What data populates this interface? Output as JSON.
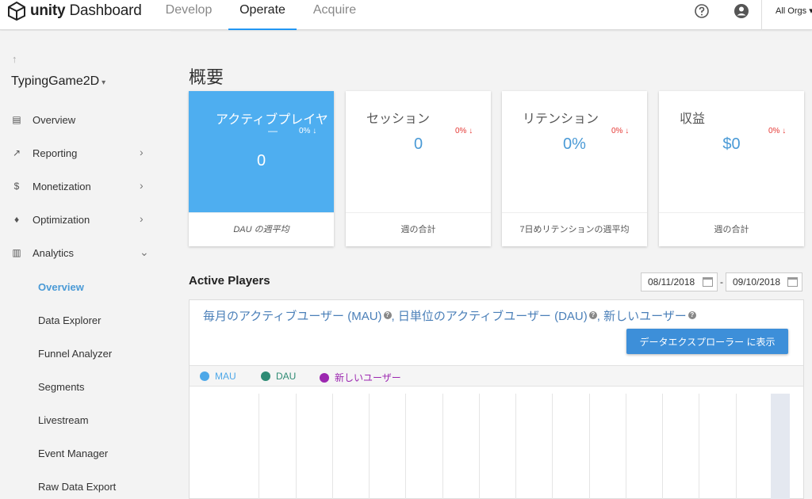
{
  "header": {
    "logo_text_bold": "unity",
    "logo_text": " Dashboard",
    "tabs": [
      {
        "label": "Develop"
      },
      {
        "label": "Operate"
      },
      {
        "label": "Acquire"
      }
    ],
    "org_label": "All Orgs",
    "icons": [
      "help-icon",
      "account-icon"
    ]
  },
  "sidebar": {
    "back_glyph": "↑",
    "project_name": "TypingGame2D",
    "project_caret": "▾",
    "items": [
      {
        "label": "Overview",
        "icon": "overview-icon",
        "glyph": "▤"
      },
      {
        "label": "Reporting",
        "icon": "reporting-icon",
        "glyph": "↗",
        "chevron": "›"
      },
      {
        "label": "Monetization",
        "icon": "dollar-icon",
        "glyph": "$",
        "chevron": "›"
      },
      {
        "label": "Optimization",
        "icon": "lightbulb-icon",
        "glyph": "♦",
        "chevron": "›"
      },
      {
        "label": "Analytics",
        "icon": "analytics-icon",
        "glyph": "▥",
        "chevron": "⌄"
      }
    ],
    "subitems": [
      {
        "label": "Overview"
      },
      {
        "label": "Data Explorer"
      },
      {
        "label": "Funnel Analyzer"
      },
      {
        "label": "Segments"
      },
      {
        "label": "Livestream"
      },
      {
        "label": "Event Manager"
      },
      {
        "label": "Raw Data Export"
      }
    ]
  },
  "main": {
    "title": "概要",
    "cards": [
      {
        "title": "アクティブプレイヤ",
        "dash": "—",
        "delta": "0% ↓",
        "value": "0",
        "footer": "DAU の週平均"
      },
      {
        "title": "セッション",
        "delta": "0% ↓",
        "value": "0",
        "footer": "週の合計"
      },
      {
        "title": "リテンション",
        "delta": "0% ↓",
        "value": "0%",
        "footer": "7日めリテンションの週平均"
      },
      {
        "title": "収益",
        "delta": "0% ↓",
        "value": "$0",
        "footer": "週の合計"
      }
    ],
    "active_players": {
      "title": "Active Players",
      "date_from": "08/11/2018",
      "date_sep": "-",
      "date_to": "09/10/2018",
      "panel_title_parts": [
        "毎月のアクティブユーザー (MAU)",
        ", 日単位のアクティブユーザー (DAU)",
        ", 新しいユーザー"
      ],
      "help_glyph": "?",
      "explore_button": "データエクスプローラー に表示",
      "legend": [
        {
          "label": "MAU",
          "color": "#4ea8e8"
        },
        {
          "label": "DAU",
          "color": "#2e8b74"
        },
        {
          "label": "新しいユーザー",
          "color": "#9c27b0"
        }
      ]
    }
  },
  "colors": {
    "accent": "#2196f3",
    "card_highlight": "#4eaef0",
    "value_blue": "#4a9ad6",
    "delta_red": "#e53935",
    "button_blue": "#3d8fd9"
  }
}
